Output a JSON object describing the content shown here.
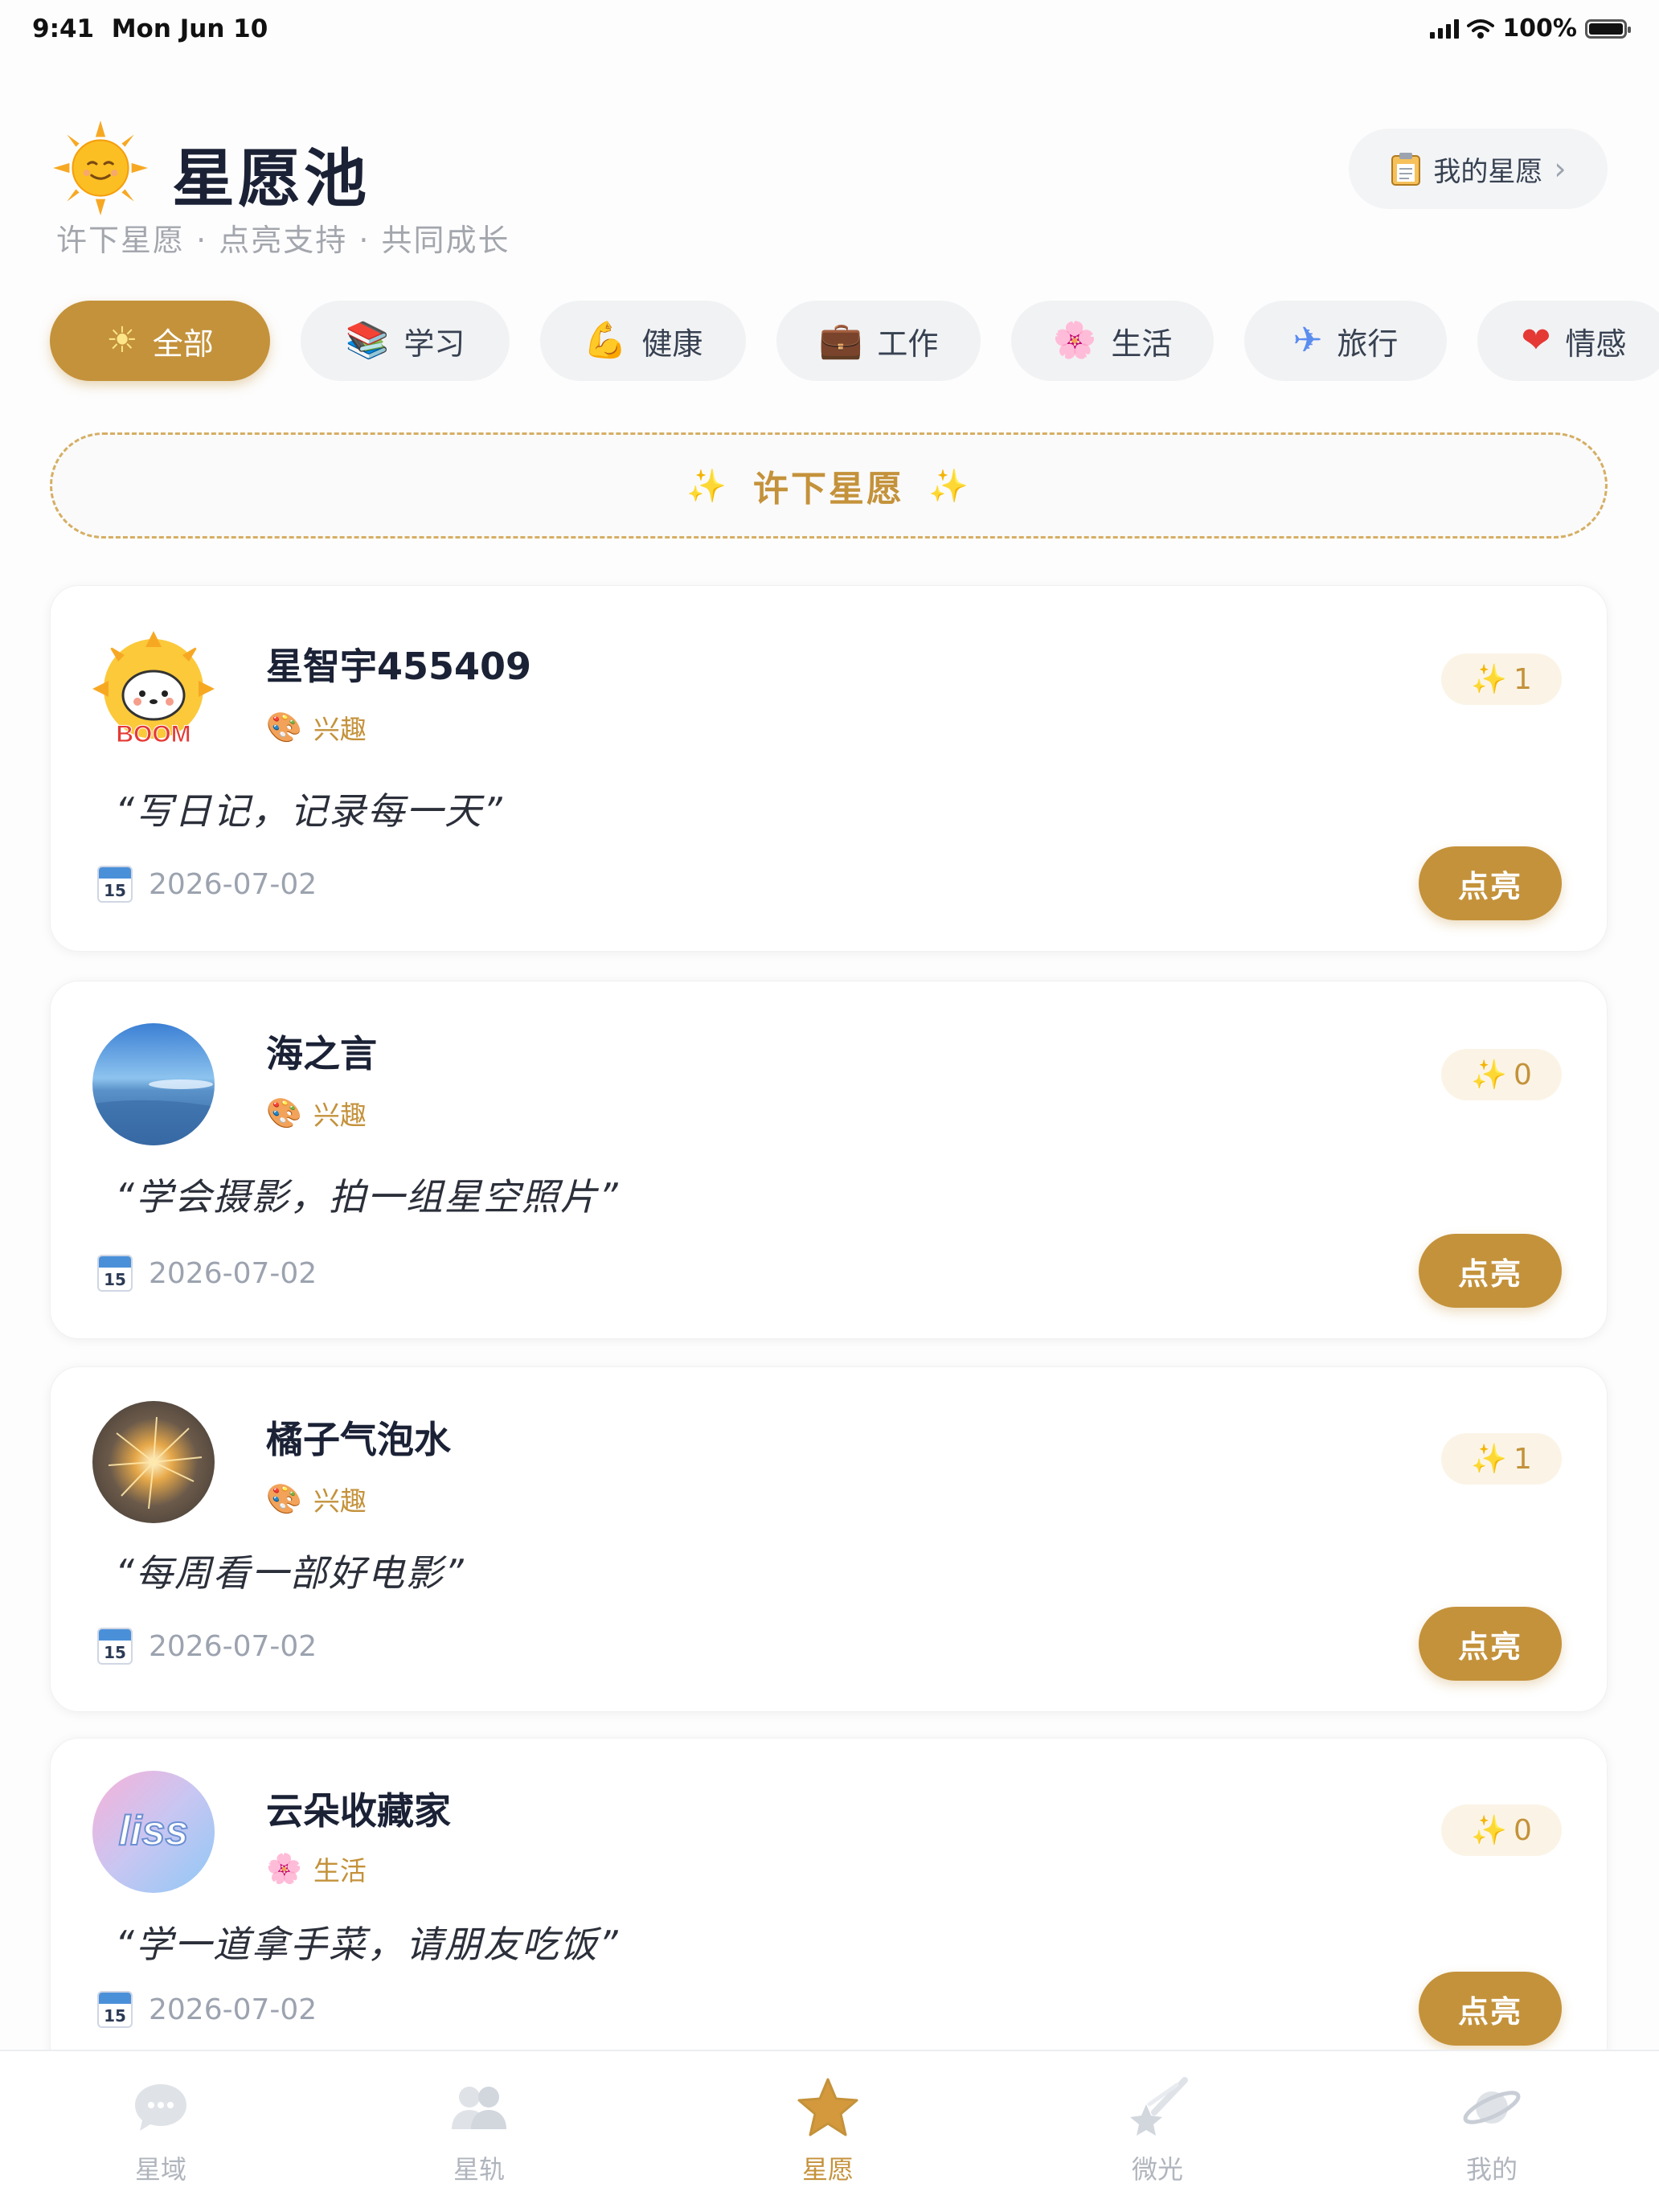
{
  "status_bar": {
    "time": "9:41",
    "date": "Mon Jun 10",
    "battery": "100%"
  },
  "header": {
    "title": "星愿池",
    "subtitle": "许下星愿 · 点亮支持 · 共同成长",
    "my_wishes_label": "我的星愿",
    "my_wishes_chevron": "›"
  },
  "categories": [
    {
      "emoji": "☀",
      "label": "全部"
    },
    {
      "emoji": "📚",
      "label": "学习"
    },
    {
      "emoji": "💪",
      "label": "健康"
    },
    {
      "emoji": "💼",
      "label": "工作"
    },
    {
      "emoji": "🌸",
      "label": "生活"
    },
    {
      "emoji": "✈",
      "label": "旅行"
    },
    {
      "emoji": "❤",
      "label": "情感"
    }
  ],
  "make_wish": {
    "spark": "✨",
    "label": "许下星愿"
  },
  "wishes": [
    {
      "user": "星智宇455409",
      "tag_emoji": "🎨",
      "tag": "兴趣",
      "count_icon": "✨",
      "count": "1",
      "text": "“写日记，记录每一天”",
      "cal_num": "15",
      "date": "2026-07-02",
      "button": "点亮"
    },
    {
      "user": "海之言",
      "tag_emoji": "🎨",
      "tag": "兴趣",
      "count_icon": "✨",
      "count": "0",
      "text": "“学会摄影，拍一组星空照片”",
      "cal_num": "15",
      "date": "2026-07-02",
      "button": "点亮"
    },
    {
      "user": "橘子气泡水",
      "tag_emoji": "🎨",
      "tag": "兴趣",
      "count_icon": "✨",
      "count": "1",
      "text": "“每周看一部好电影”",
      "cal_num": "15",
      "date": "2026-07-02",
      "button": "点亮"
    },
    {
      "user": "云朵收藏家",
      "tag_emoji": "🌸",
      "tag": "生活",
      "count_icon": "✨",
      "count": "0",
      "text": "“学一道拿手菜，请朋友吃饭”",
      "cal_num": "15",
      "date": "2026-07-02",
      "button": "点亮"
    }
  ],
  "avatar_logo_text": [
    "BOOM",
    "liss"
  ],
  "tabbar": [
    {
      "icon": "chat-bubble-icon",
      "label": "星域"
    },
    {
      "icon": "people-icon",
      "label": "星轨"
    },
    {
      "icon": "star-icon",
      "label": "星愿"
    },
    {
      "icon": "shooting-star-icon",
      "label": "微光"
    },
    {
      "icon": "planet-icon",
      "label": "我的"
    }
  ],
  "colors": {
    "accent": "#c4923b",
    "accent_light": "#fbf4e6",
    "text": "#1b2236",
    "muted": "#9ca3af"
  }
}
